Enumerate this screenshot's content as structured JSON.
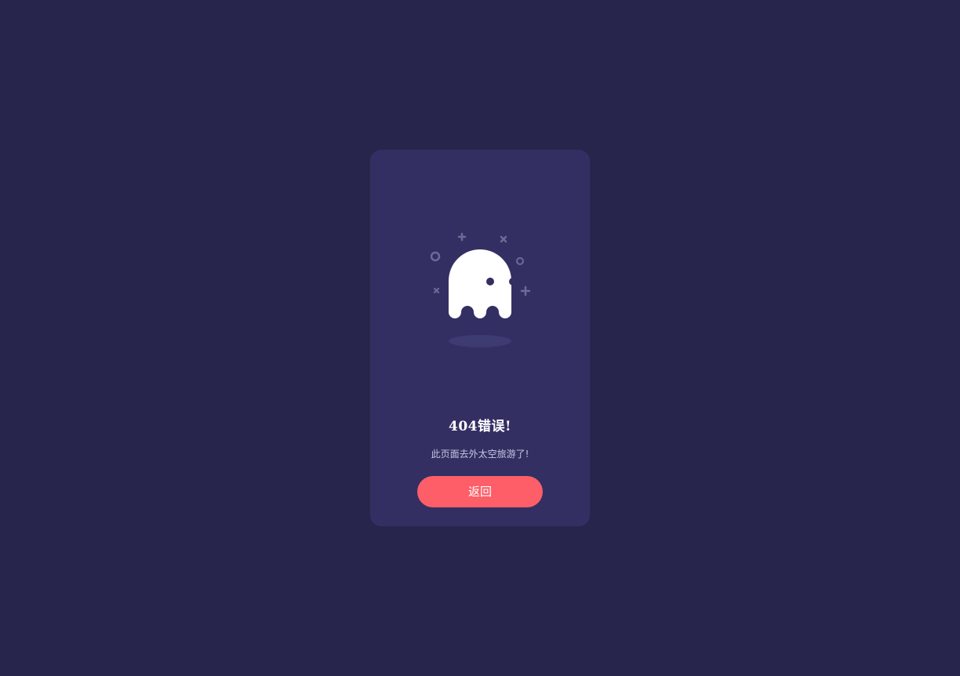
{
  "error": {
    "title": "404错误!",
    "message": "此页面去外太空旅游了!",
    "back_label": "返回"
  },
  "illustration": {
    "icon": "ghost-icon",
    "decorations": [
      "circle-icon",
      "plus-icon",
      "cross-icon",
      "circle-icon",
      "cross-icon",
      "plus-icon"
    ]
  },
  "colors": {
    "page_background": "#28254c",
    "card_background": "#332f63",
    "accent": "#fe5e67",
    "ghost": "#ffffff",
    "decoration": "#6e6a96"
  }
}
